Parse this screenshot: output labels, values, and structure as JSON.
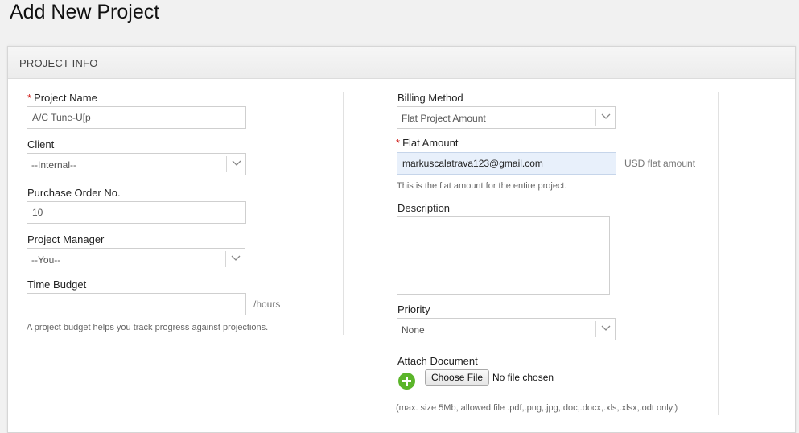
{
  "page": {
    "title": "Add New Project"
  },
  "panel": {
    "header": "PROJECT INFO"
  },
  "left": {
    "project_name": {
      "label": "Project Name",
      "required_mark": "*",
      "value": "A/C Tune-U[p"
    },
    "client": {
      "label": "Client",
      "selected": "--Internal--"
    },
    "purchase_order": {
      "label": "Purchase Order No.",
      "value": "10"
    },
    "project_manager": {
      "label": "Project Manager",
      "selected": "--You--"
    },
    "time_budget": {
      "label": "Time Budget",
      "value": "",
      "suffix": "/hours",
      "hint": "A project budget helps you track progress against projections."
    }
  },
  "right": {
    "billing_method": {
      "label": "Billing Method",
      "selected": "Flat Project Amount"
    },
    "flat_amount": {
      "label": "Flat Amount",
      "required_mark": "*",
      "value": "markuscalatrava123@gmail.com",
      "suffix": "USD flat amount",
      "hint": "This is the flat amount for the entire project."
    },
    "description": {
      "label": "Description",
      "value": ""
    },
    "priority": {
      "label": "Priority",
      "selected": "None"
    },
    "attach": {
      "label": "Attach Document",
      "button": "Choose File",
      "status": "No file chosen",
      "note": "(max. size 5Mb, allowed file .pdf,.png,.jpg,.doc,.docx,.xls,.xlsx,.odt only.)"
    }
  },
  "icons": {
    "dropdown": "chevron-down-icon",
    "add": "plus-circle-icon"
  },
  "colors": {
    "required": "#d0211c",
    "add_icon": "#5bb52a",
    "autofill": "#e8f0fb"
  }
}
